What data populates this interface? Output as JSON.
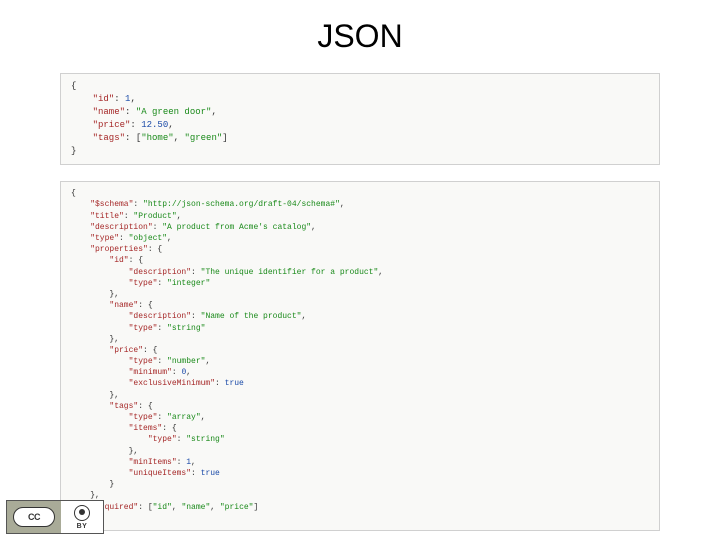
{
  "title": "JSON",
  "code1": {
    "open": "{",
    "l1": {
      "k": "\"id\"",
      "v": "1"
    },
    "l2": {
      "k": "\"name\"",
      "v": "\"A green door\""
    },
    "l3": {
      "k": "\"price\"",
      "v": "12.50"
    },
    "l4": {
      "k": "\"tags\"",
      "v1": "\"home\"",
      "v2": "\"green\""
    },
    "close": "}"
  },
  "code2": {
    "open": "{",
    "schema_k": "\"$schema\"",
    "schema_v": "\"http://json-schema.org/draft-04/schema#\"",
    "title_k": "\"title\"",
    "title_v": "\"Product\"",
    "desc_k": "\"description\"",
    "desc_v": "\"A product from Acme's catalog\"",
    "type_k": "\"type\"",
    "type_v": "\"object\"",
    "props_k": "\"properties\"",
    "id_k": "\"id\"",
    "id_desc_k": "\"description\"",
    "id_desc_v": "\"The unique identifier for a product\"",
    "id_type_k": "\"type\"",
    "id_type_v": "\"integer\"",
    "name_k": "\"name\"",
    "name_desc_k": "\"description\"",
    "name_desc_v": "\"Name of the product\"",
    "name_type_k": "\"type\"",
    "name_type_v": "\"string\"",
    "price_k": "\"price\"",
    "price_type_k": "\"type\"",
    "price_type_v": "\"number\"",
    "price_min_k": "\"minimum\"",
    "price_min_v": "0",
    "price_excl_k": "\"exclusiveMinimum\"",
    "price_excl_v": "true",
    "tags_k": "\"tags\"",
    "tags_type_k": "\"type\"",
    "tags_type_v": "\"array\"",
    "items_k": "\"items\"",
    "items_type_k": "\"type\"",
    "items_type_v": "\"string\"",
    "minitems_k": "\"minItems\"",
    "minitems_v": "1",
    "unique_k": "\"uniqueItems\"",
    "unique_v": "true",
    "req_k": "\"required\"",
    "req_v1": "\"id\"",
    "req_v2": "\"name\"",
    "req_v3": "\"price\"",
    "close": "}"
  },
  "footer": {
    "cc": "CC",
    "by": "BY"
  }
}
